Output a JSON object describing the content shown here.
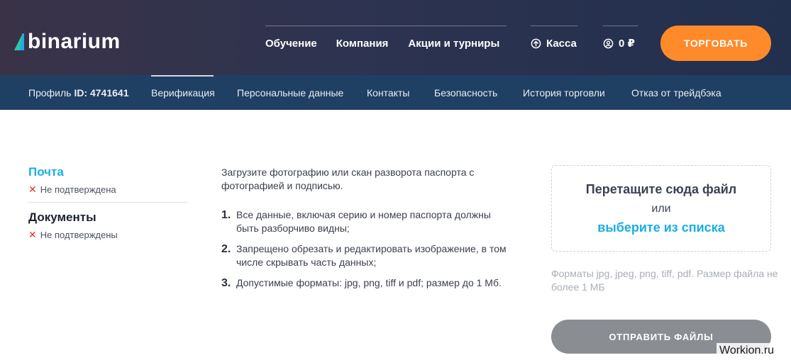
{
  "header": {
    "logo_text": "binarium",
    "nav": {
      "learning": "Обучение",
      "company": "Компания",
      "promos": "Акции и турниры",
      "cashier": "Касса",
      "balance": "0 ₽"
    },
    "trade_button": "ТОРГОВАТЬ"
  },
  "subnav": {
    "profile_label": "Профиль",
    "profile_id": "ID: 4741641",
    "items": [
      "Верификация",
      "Персональные данные",
      "Контакты",
      "Безопасность",
      "История торговли",
      "Отказ от трейдбэка"
    ]
  },
  "status": {
    "email_title": "Почта",
    "email_status": "Не подтверждена",
    "docs_title": "Документы",
    "docs_status": "Не подтверждены"
  },
  "instructions": {
    "intro": "Загрузите фотографию или скан разворота паспорта с фотографией и подписью.",
    "rules": [
      {
        "num": "1.",
        "text": "Все данные, включая серию и номер паспорта должны быть разборчиво видны;"
      },
      {
        "num": "2.",
        "text": "Запрещено обрезать и редактировать изображение, в том числе скрывать часть данных;"
      },
      {
        "num": "3.",
        "text": "Допустимые форматы: jpg, png, tiff и pdf; размер до 1 Мб."
      }
    ]
  },
  "upload": {
    "drop_title": "Перетащите сюда файл",
    "drop_or": "или",
    "drop_link": "выберите из списка",
    "formats": "Форматы jpg, jpeg, png, tiff, pdf. Размер файла не более 1 МБ",
    "send_button": "ОТПРАВИТЬ ФАЙЛЫ"
  },
  "watermark": "Workion.ru",
  "colors": {
    "accent_blue": "#1aaee4",
    "trade_orange": "#ff8a2a",
    "subnav_bg": "#1f3f63",
    "error_red": "#e0332f",
    "disabled_gray": "#8a8d92"
  },
  "icons": {
    "logo": "binarium-logo-icon",
    "cashier": "arrow-up-circle-icon",
    "balance": "user-circle-icon",
    "status": "close-icon"
  }
}
